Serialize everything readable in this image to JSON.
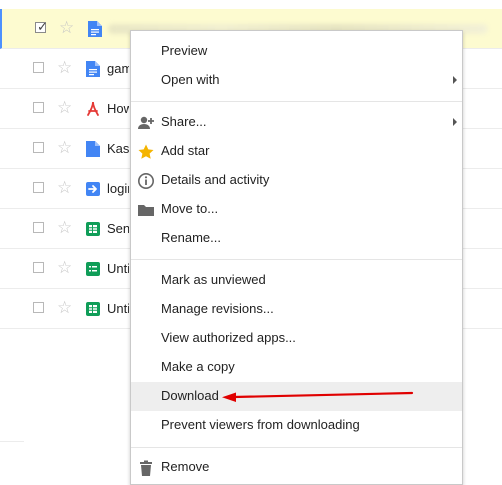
{
  "files": [
    {
      "name": "",
      "type": "doc",
      "selected": true
    },
    {
      "name": "gam",
      "type": "doc",
      "selected": false
    },
    {
      "name": "How",
      "type": "pdf",
      "selected": false
    },
    {
      "name": "Kas",
      "type": "doc",
      "selected": false
    },
    {
      "name": "login",
      "type": "shortcut",
      "selected": false
    },
    {
      "name": "Sen",
      "type": "sheet",
      "selected": false
    },
    {
      "name": "Unti",
      "type": "form",
      "selected": false
    },
    {
      "name": "Unti",
      "type": "sheet",
      "selected": false
    }
  ],
  "menu": {
    "preview": "Preview",
    "open_with": "Open with",
    "share": "Share...",
    "add_star": "Add star",
    "details": "Details and activity",
    "move_to": "Move to...",
    "rename": "Rename...",
    "mark_unviewed": "Mark as unviewed",
    "manage_revisions": "Manage revisions...",
    "view_apps": "View authorized apps...",
    "make_copy": "Make a copy",
    "download": "Download",
    "prevent_download": "Prevent viewers from downloading",
    "remove": "Remove"
  },
  "colors": {
    "selected_row_bg": "#fdfbd0",
    "selection_accent": "#4d90fe",
    "doc_icon": "#4285f4",
    "pdf_icon": "#e53935",
    "sheet_icon": "#0f9d58",
    "star_active": "#f4b400",
    "annotation_arrow": "#e00000"
  },
  "icons": {
    "share": "person-add-icon",
    "add_star": "star-icon",
    "details": "info-icon",
    "move_to": "folder-icon",
    "remove": "trash-icon"
  }
}
